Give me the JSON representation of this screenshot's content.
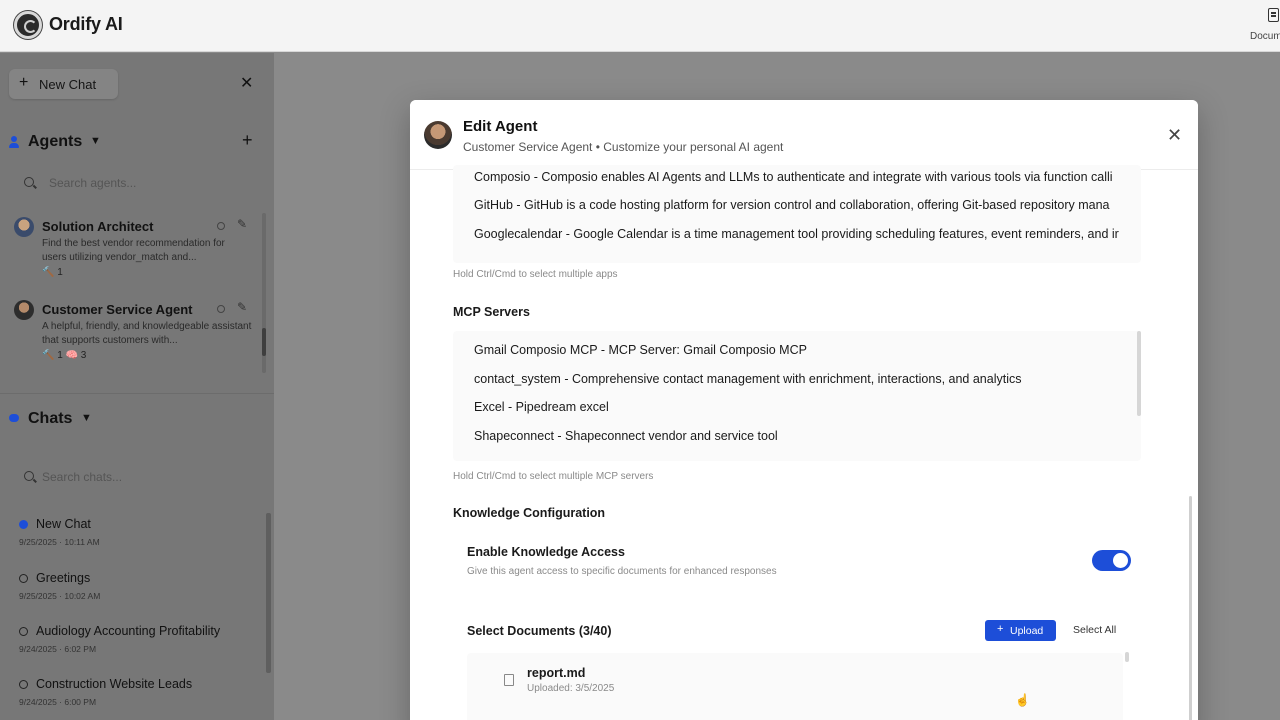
{
  "app": {
    "title": "Ordify AI",
    "docs_label": "Docum"
  },
  "sidebar": {
    "new_chat_label": "New Chat",
    "agents": {
      "title": "Agents",
      "search_placeholder": "Search agents...",
      "items": [
        {
          "name": "Solution Architect",
          "description": "Find the best vendor recommendation for users utilizing vendor_match and...",
          "meta": "🔨 1"
        },
        {
          "name": "Customer Service Agent",
          "description": "A helpful, friendly, and knowledgeable assistant that supports customers with...",
          "meta": "🔨 1  🧠 3"
        }
      ]
    },
    "chats": {
      "title": "Chats",
      "search_placeholder": "Search chats...",
      "items": [
        {
          "title": "New Chat",
          "date": "9/25/2025 · 10:11 AM",
          "active": true
        },
        {
          "title": "Greetings",
          "date": "9/25/2025 · 10:02 AM",
          "active": false
        },
        {
          "title": "Audiology Accounting Profitability",
          "date": "9/24/2025 · 6:02 PM",
          "active": false
        },
        {
          "title": "Construction Website Leads",
          "date": "9/24/2025 · 6:00 PM",
          "active": false
        }
      ]
    }
  },
  "modal": {
    "title": "Edit Agent",
    "subtitle": "Customer Service Agent • Customize your personal AI agent",
    "apps": [
      "Composio - Composio enables AI Agents and LLMs to authenticate and integrate with various tools via function calli",
      "GitHub - GitHub is a code hosting platform for version control and collaboration, offering Git-based repository mana",
      "Googlecalendar - Google Calendar is a time management tool providing scheduling features, event reminders, and ir"
    ],
    "apps_hint": "Hold Ctrl/Cmd to select multiple apps",
    "mcp_title": "MCP Servers",
    "mcp_servers": [
      "Gmail Composio MCP - MCP Server: Gmail Composio MCP",
      "contact_system - Comprehensive contact management with enrichment, interactions, and analytics",
      "Excel - Pipedream excel",
      "Shapeconnect - Shapeconnect vendor and service tool"
    ],
    "mcp_hint": "Hold Ctrl/Cmd to select multiple MCP servers",
    "knowledge": {
      "section_title": "Knowledge Configuration",
      "enable_title": "Enable Knowledge Access",
      "enable_desc": "Give this agent access to specific documents for enhanced responses",
      "enabled": true,
      "select_docs_title": "Select Documents (3/40)",
      "upload_label": "Upload",
      "select_all_label": "Select All",
      "documents": [
        {
          "name": "report.md",
          "uploaded": "Uploaded: 3/5/2025"
        }
      ]
    }
  },
  "colors": {
    "accent": "#1d4ed8",
    "overlay": "#8a8a8a"
  }
}
